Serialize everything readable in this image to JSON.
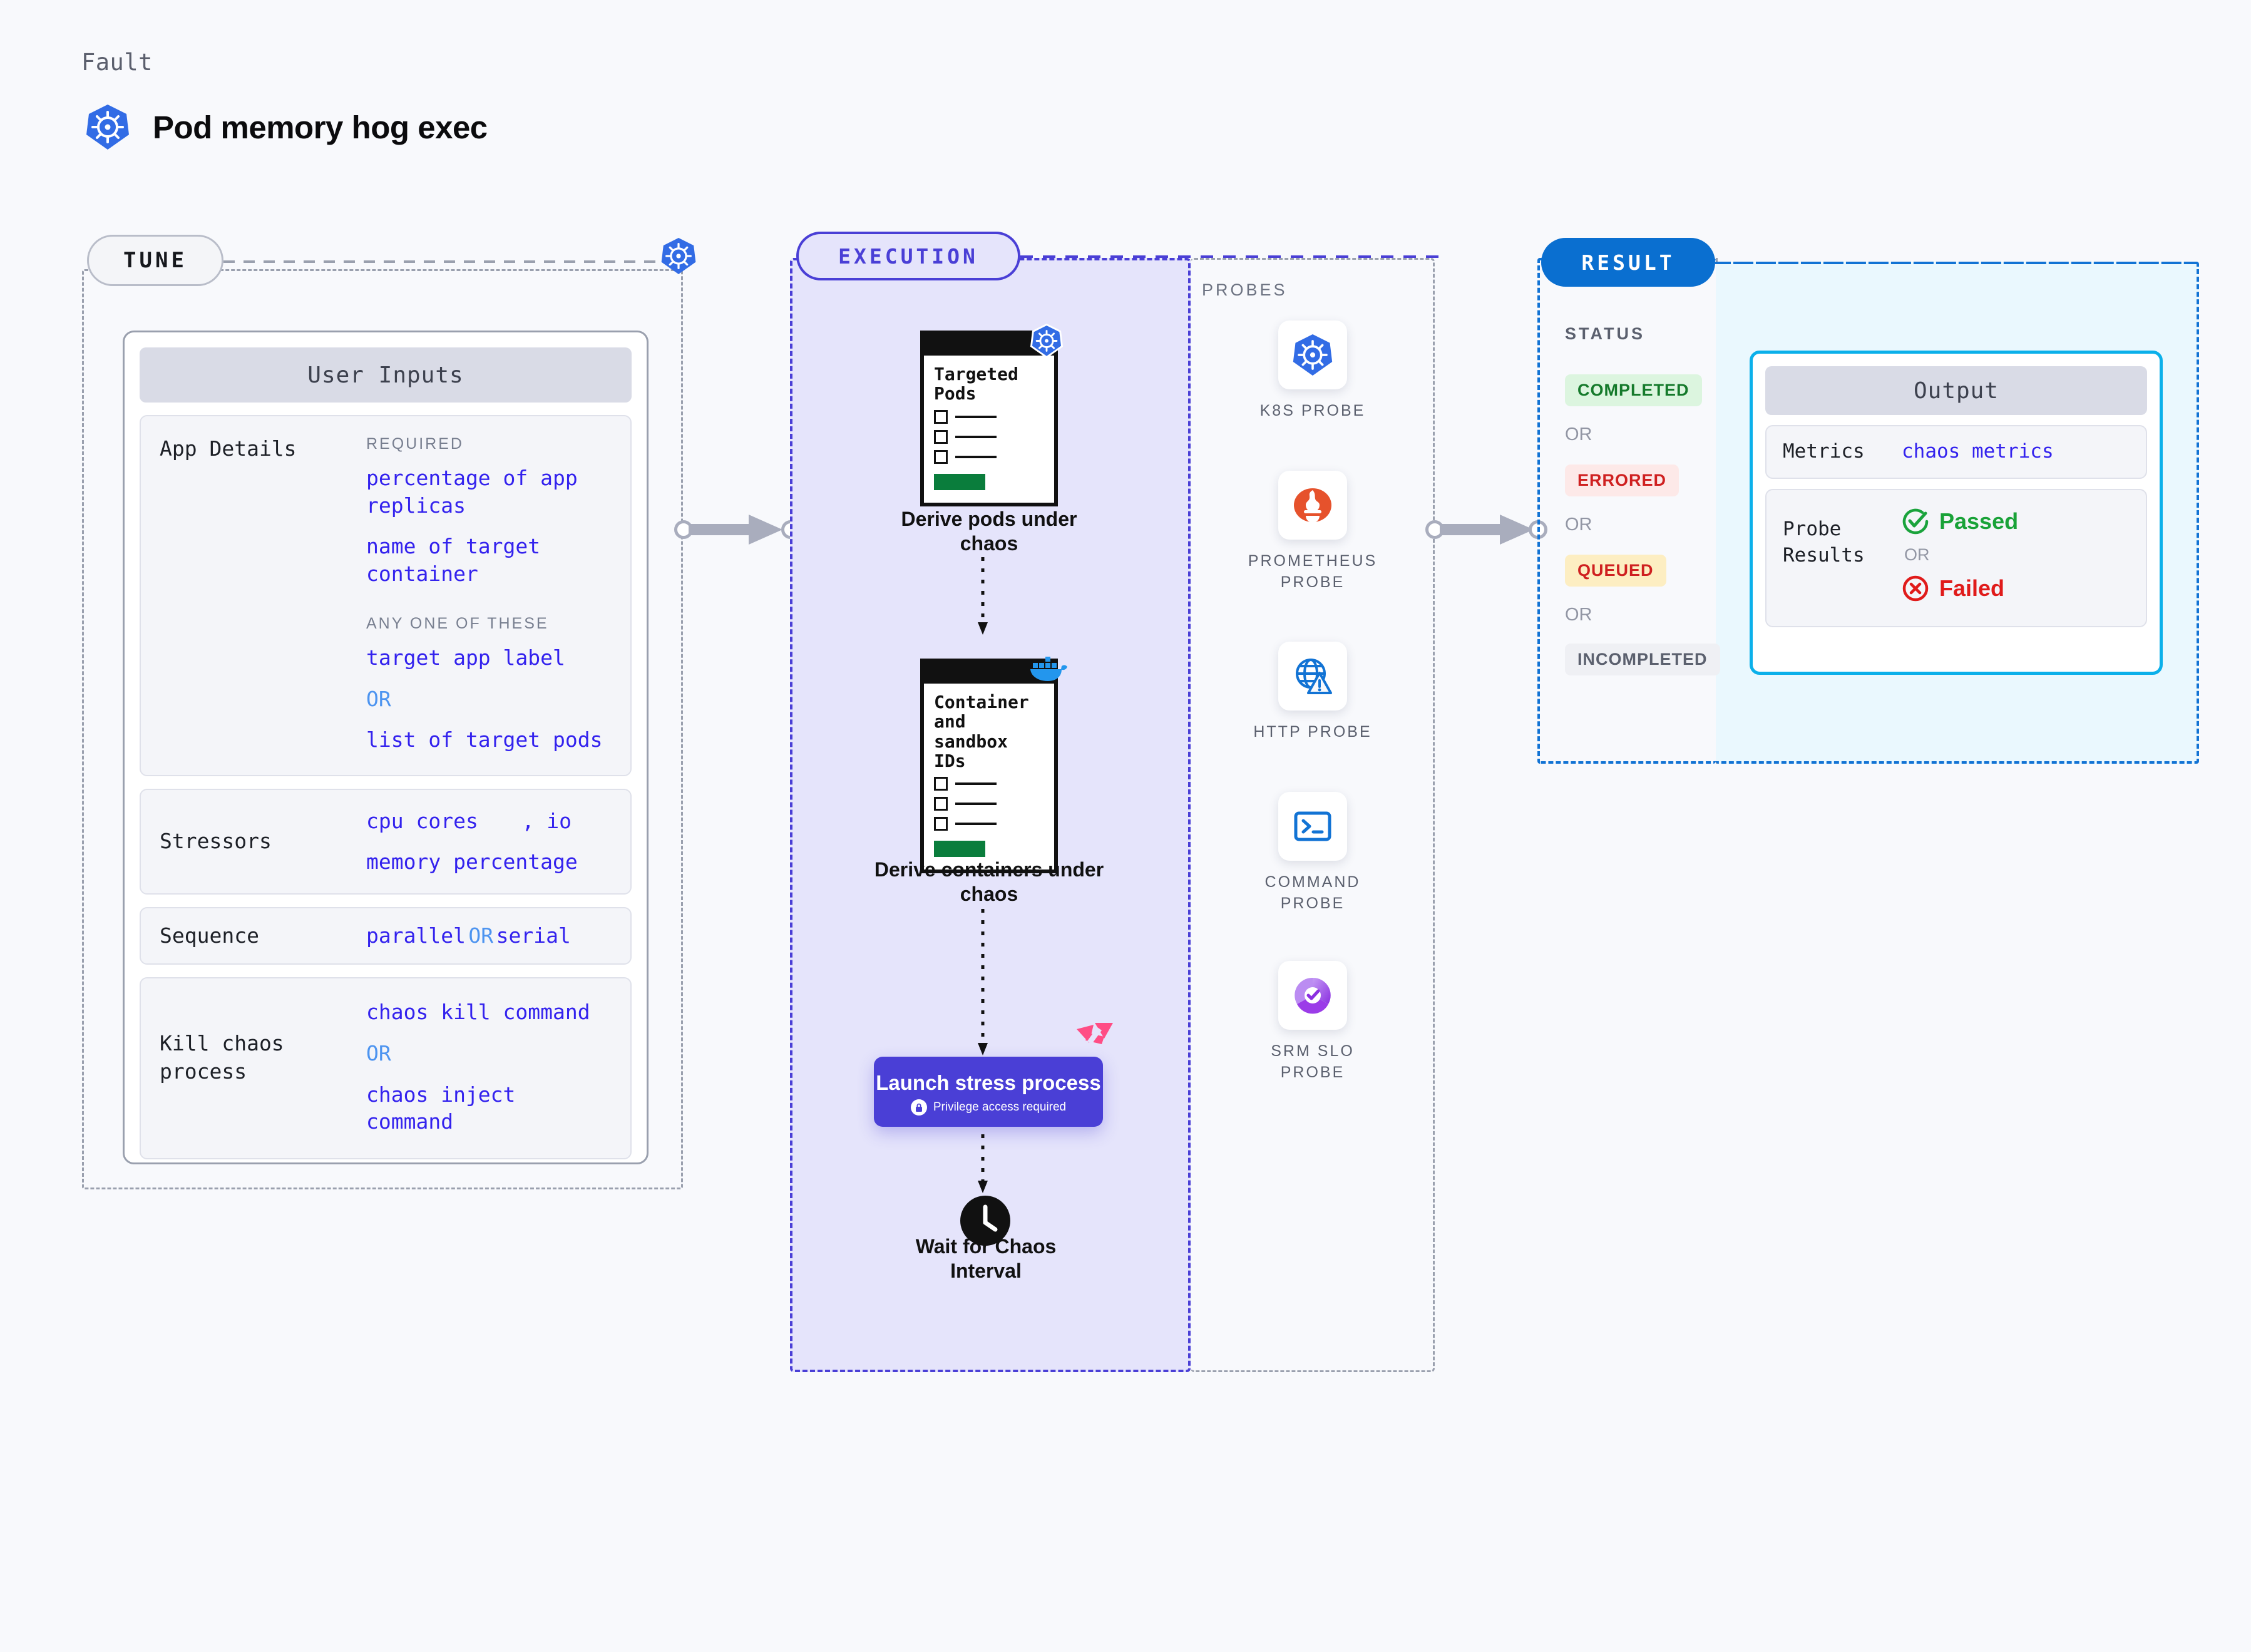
{
  "header": {
    "eyebrow": "Fault",
    "title": "Pod memory hog exec",
    "icon": "kubernetes-icon"
  },
  "colors": {
    "page_bg": "#f8f9fc",
    "tune_border": "#9aa0ae",
    "execution_accent": "#4a3fd6",
    "execution_bg": "#e5e4fb",
    "result_accent": "#1273d4",
    "result_bg": "#eaf8fe",
    "output_border": "#0bb0ea",
    "mono_blue": "#3322ee",
    "or_blue": "#4d94f0",
    "harness_pink": "#ff4d85",
    "kubernetes_blue": "#326ce5",
    "docker_blue": "#2396ed",
    "prometheus_orange": "#e6522c",
    "green": "#0a7d3c"
  },
  "tune": {
    "badge": "TUNE",
    "card_title": "User Inputs",
    "rows": [
      {
        "label": "App Details",
        "groups": [
          {
            "kicker": "REQUIRED",
            "values": [
              "percentage of app replicas",
              "name of target container"
            ]
          },
          {
            "kicker": "ANY ONE OF THESE",
            "values": [
              "target app label",
              "OR",
              "list of target pods"
            ]
          }
        ]
      },
      {
        "label": "Stressors",
        "values_line1": "cpu cores",
        "values_sep": ", io",
        "values_line2": "memory percentage"
      },
      {
        "label": "Sequence",
        "value_a": "parallel",
        "value_or": "OR",
        "value_b": "serial"
      },
      {
        "label": "Kill chaos process",
        "values": [
          "chaos kill command",
          "OR",
          "chaos inject command"
        ]
      }
    ]
  },
  "execution": {
    "badge": "EXECUTION",
    "nodes": [
      {
        "doc_title": "Targeted Pods",
        "caption": "Derive pods under chaos",
        "corner_icon": "kubernetes-icon"
      },
      {
        "doc_title": "Container and sandbox IDs",
        "caption": "Derive containers under chaos",
        "corner_icon": "docker-icon"
      }
    ],
    "launch": {
      "title": "Launch stress process",
      "privilege": "Privilege access required",
      "corner_icon": "harness-icon",
      "lock_icon": "lock-icon"
    },
    "wait": {
      "caption": "Wait for Chaos Interval",
      "icon": "clock-icon"
    }
  },
  "probes": {
    "title": "PROBES",
    "items": [
      {
        "label": "K8S PROBE",
        "icon": "kubernetes-icon"
      },
      {
        "label": "PROMETHEUS PROBE",
        "icon": "prometheus-icon"
      },
      {
        "label": "HTTP PROBE",
        "icon": "http-globe-icon"
      },
      {
        "label": "COMMAND PROBE",
        "icon": "terminal-icon"
      },
      {
        "label": "SRM SLO PROBE",
        "icon": "srm-slo-icon"
      }
    ]
  },
  "result": {
    "badge": "RESULT",
    "status_label": "STATUS",
    "or_text": "OR",
    "statuses": [
      {
        "label": "COMPLETED",
        "bg": "#dcf5df",
        "fg": "#157a2b"
      },
      {
        "label": "ERRORED",
        "bg": "#fde9e8",
        "fg": "#cf2020"
      },
      {
        "label": "QUEUED",
        "bg": "#fdeec2",
        "fg": "#cf2020"
      },
      {
        "label": "INCOMPLETED",
        "bg": "#eff0f4",
        "fg": "#5b606e"
      }
    ],
    "output": {
      "title": "Output",
      "metrics_label": "Metrics",
      "metrics_value": "chaos metrics",
      "probe_results_label": "Probe Results",
      "passed": "Passed",
      "or_text": "OR",
      "failed": "Failed",
      "passed_icon": "check-circle-icon",
      "failed_icon": "x-circle-icon"
    }
  }
}
